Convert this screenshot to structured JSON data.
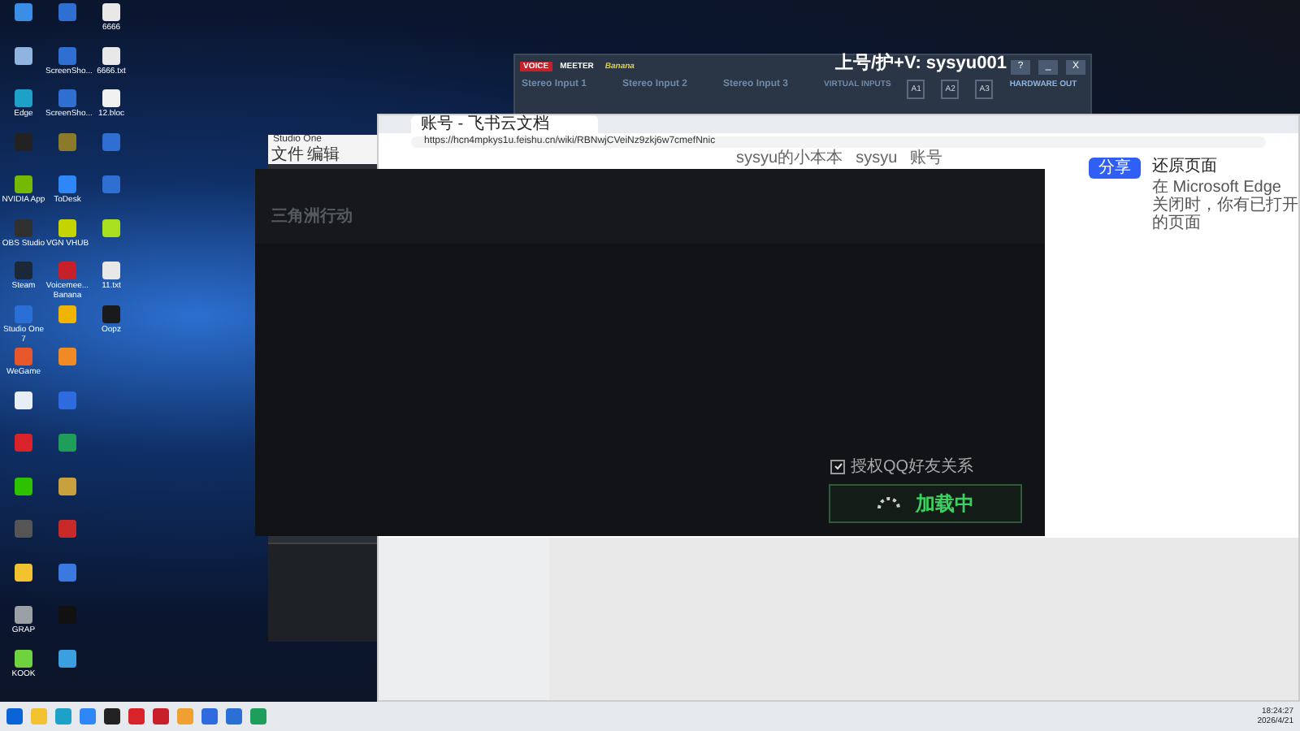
{
  "desktop_icons": [
    {
      "color": "#3a8ee6"
    },
    {
      "color": "#8fb4e0"
    },
    {
      "label": "Edge",
      "color": "#1ea1c9"
    },
    {
      "color": "#222222"
    },
    {
      "label": "NVIDIA App",
      "color": "#76b900"
    },
    {
      "label": "OBS Studio",
      "color": "#303030"
    },
    {
      "label": "Steam",
      "color": "#1b2838"
    },
    {
      "label": "Studio One 7",
      "color": "#2a6fd6"
    },
    {
      "label": "WeGame",
      "color": "#e8572a"
    },
    {
      "color": "#e8eef5"
    },
    {
      "color": "#d8232a"
    },
    {
      "color": "#2dc100"
    },
    {
      "color": "#555555"
    },
    {
      "color": "#f2c230"
    },
    {
      "label": "GRAP",
      "color": "#9aa0a6"
    },
    {
      "label": "KOOK",
      "color": "#6fd340"
    },
    {
      "color": "#2f6fd1"
    },
    {
      "label": "ScreenSho...",
      "color": "#2f6fd1"
    },
    {
      "label": "ScreenSho...",
      "color": "#2f6fd1"
    },
    {
      "color": "#8a7a2a"
    },
    {
      "label": "ToDesk",
      "color": "#2f86f6"
    },
    {
      "label": "VGN VHUB",
      "color": "#c3d400"
    },
    {
      "label": "Voicemee... Banana",
      "color": "#c8202a"
    },
    {
      "color": "#f0b400"
    },
    {
      "color": "#f08a24"
    },
    {
      "color": "#2e6ae0"
    },
    {
      "color": "#1e9e5a"
    },
    {
      "color": "#c8a040"
    },
    {
      "color": "#c82a2a"
    },
    {
      "color": "#3a7ae0"
    },
    {
      "color": "#111111"
    },
    {
      "color": "#3aa0e0"
    },
    {
      "label": "6666",
      "color": "#e8e8e8"
    },
    {
      "label": "6666.txt",
      "color": "#e8e8e8"
    },
    {
      "label": "12.bloc",
      "color": "#f0f0f0"
    },
    {
      "color": "#2f6fd1"
    },
    {
      "color": "#2f6fd1"
    },
    {
      "color": "#a8e020"
    },
    {
      "label": "11.txt",
      "color": "#e8e8e8"
    },
    {
      "label": "Oopz",
      "color": "#1a1a1a"
    }
  ],
  "overlay_text": "上号/护+V: sysyu001",
  "voicemeeter": {
    "brand": [
      "VOICE",
      "MEETER",
      "Banana"
    ],
    "inputs": [
      "Stereo Input 1",
      "Stereo Input 2",
      "Stereo Input 3"
    ],
    "virtual_inputs": "VIRTUAL INPUTS",
    "buses": [
      "A1",
      "A2",
      "A3"
    ],
    "hardware_out": "HARDWARE OUT",
    "window_buttons": [
      "?",
      "_",
      "X"
    ]
  },
  "browser": {
    "tab": "账号 - 飞书云文档",
    "url": "https://hcn4mpkys1u.feishu.cn/wiki/RBNwjCVeiNz9zkj6w7cmefNnic",
    "breadcrumb": [
      "sysyu的小本本",
      "sysyu",
      "账号"
    ],
    "share": "分享",
    "restore_title": "还原页面",
    "restore_text": "在 Microsoft Edge 关闭时，你有已打开的页面"
  },
  "studio_one": {
    "title": "Studio One",
    "menu": [
      "文件",
      "编辑"
    ]
  },
  "launcher": {
    "logo": "三角洲行动",
    "authorize": {
      "label": "授权QQ好友关系",
      "checked": true
    },
    "button": "加载中"
  },
  "taskbar": {
    "apps": [
      {
        "color": "#0a64d8"
      },
      {
        "color": "#f2c230"
      },
      {
        "color": "#1ea1c9"
      },
      {
        "color": "#2f86f6"
      },
      {
        "color": "#222222"
      },
      {
        "color": "#d8232a"
      },
      {
        "color": "#c8202a"
      },
      {
        "color": "#f0a030"
      },
      {
        "color": "#2e6ae0"
      },
      {
        "color": "#2a6fd6"
      },
      {
        "color": "#1e9e5a"
      }
    ],
    "time": "18:24:27",
    "date": "2026/4/21"
  }
}
